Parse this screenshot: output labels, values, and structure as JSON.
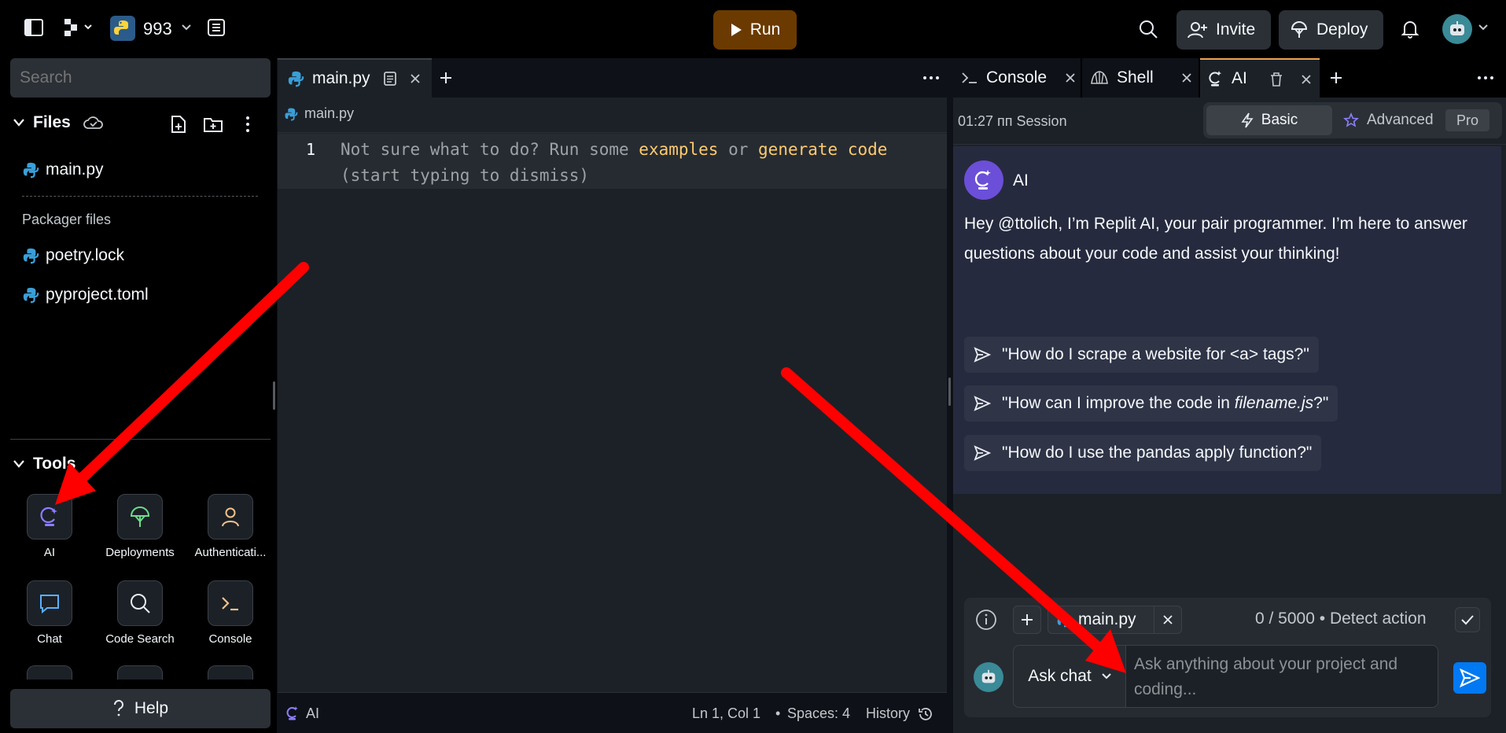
{
  "topbar": {
    "project_number": "993",
    "run_label": "Run",
    "invite_label": "Invite",
    "deploy_label": "Deploy"
  },
  "sidebar": {
    "search_placeholder": "Search",
    "files_title": "Files",
    "files": [
      {
        "name": "main.py"
      }
    ],
    "packager_title": "Packager files",
    "packager_files": [
      {
        "name": "poetry.lock"
      },
      {
        "name": "pyproject.toml"
      }
    ],
    "tools_title": "Tools",
    "tools": [
      {
        "label": "AI"
      },
      {
        "label": "Deployments"
      },
      {
        "label": "Authenticati..."
      },
      {
        "label": "Chat"
      },
      {
        "label": "Code Search"
      },
      {
        "label": "Console"
      }
    ],
    "help_label": "Help"
  },
  "editor": {
    "tab_name": "main.py",
    "path": "main.py",
    "line_number": "1",
    "hint_prefix": "Not sure what to do? Run some ",
    "hint_examples": "examples",
    "hint_or": " or ",
    "hint_generate": "generate code",
    "hint_line2": "(start typing to dismiss)",
    "status_ai": "AI",
    "status_position": "Ln 1, Col 1",
    "status_spaces": "Spaces: 4",
    "status_history": "History"
  },
  "right": {
    "tabs": [
      {
        "label": "Console"
      },
      {
        "label": "Shell"
      },
      {
        "label": "AI"
      }
    ],
    "session_label": "01:27 пп Session",
    "mode_basic": "Basic",
    "mode_advanced": "Advanced",
    "mode_pro": "Pro",
    "ai_name": "AI",
    "ai_message": "Hey @ttolich, I’m Replit AI, your pair programmer. I’m here to answer questions about your code and assist your thinking!",
    "suggestion_1": "\"How do I scrape a website for <a> tags?\"",
    "suggestion_2_pre": "\"How can I improve the code in ",
    "suggestion_2_file": "filename.js",
    "suggestion_2_post": "?\"",
    "suggestion_3": "\"How do I use the pandas apply function?\"",
    "context_file": "main.py",
    "counter": "0 / 5000",
    "detect_action": "Detect action",
    "ask_mode": "Ask chat",
    "input_placeholder": "Ask anything about your project and coding..."
  },
  "colors": {
    "run": "#6b3a00",
    "accent": "#0079f2",
    "hint_link": "#ffcb6b",
    "annotation_arrow": "#ff0000"
  }
}
